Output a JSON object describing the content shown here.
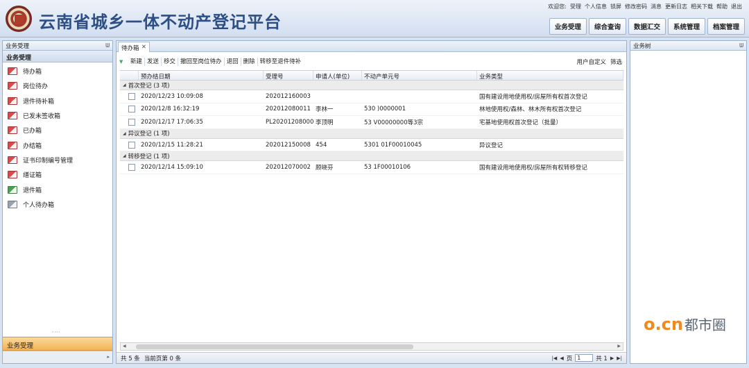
{
  "header": {
    "app_title": "云南省城乡一体不动产登记平台",
    "welcome": "欢迎您:",
    "user": "受理",
    "links": [
      "个人信息",
      "锁屏",
      "修改密码",
      "消息",
      "更新日志",
      "相关下载",
      "帮助",
      "退出"
    ],
    "nav": [
      "业务受理",
      "综合查询",
      "数据汇交",
      "系统管理",
      "档案管理"
    ]
  },
  "left_panel": {
    "title": "业务受理",
    "group": "业务受理",
    "items": [
      {
        "label": "待办箱",
        "icon": "book-red-icon"
      },
      {
        "label": "岗位待办",
        "icon": "book-red-icon"
      },
      {
        "label": "退件待补箱",
        "icon": "book-red-icon"
      },
      {
        "label": "已发未签收箱",
        "icon": "book-red-icon"
      },
      {
        "label": "已办箱",
        "icon": "book-red-icon"
      },
      {
        "label": "办结箱",
        "icon": "book-red-icon"
      },
      {
        "label": "证书印制编号管理",
        "icon": "book-red-icon"
      },
      {
        "label": "缮证箱",
        "icon": "book-red-icon"
      },
      {
        "label": "退件箱",
        "icon": "book-green-icon"
      },
      {
        "label": "个人待办箱",
        "icon": "book-gray-icon"
      }
    ],
    "bottom_tab": "业务受理"
  },
  "center": {
    "tab_label": "待办箱",
    "toolbar": [
      "新建",
      "发送",
      "移交",
      "撤回至岗位待办",
      "退回",
      "删除",
      "转移至退件待补"
    ],
    "toolbar_right": [
      "用户自定义",
      "筛选"
    ],
    "columns": [
      "预办结日期",
      "受理号",
      "申请人(单位)",
      "不动产单元号",
      "业务类型"
    ],
    "groups": [
      {
        "label": "首次登记 (3 项)",
        "rows": [
          [
            "2020/12/23 10:09:08",
            "202012160003",
            "",
            "",
            "国有建设用地使用权/房屋所有权首次登记"
          ],
          [
            "2020/12/8 16:32:19",
            "202012080011",
            "李林一",
            "530                              )0000001",
            "林地使用权/森林、林木所有权首次登记"
          ],
          [
            "2020/12/17 17:06:35",
            "PL20201208000",
            "李顶明",
            "53                              V00000000等3宗",
            "宅基地使用权首次登记（批量）"
          ]
        ]
      },
      {
        "label": "异议登记 (1 项)",
        "rows": [
          [
            "2020/12/15 11:28:21",
            "202012150008",
            "454",
            "5301                        01F00010045",
            "异议登记"
          ]
        ]
      },
      {
        "label": "转移登记 (1 项)",
        "rows": [
          [
            "2020/12/14 15:09:10",
            "202012070002",
            "顾晓芬",
            "53                            1F00010106",
            "国有建设用地使用权/房屋所有权转移登记"
          ]
        ]
      }
    ],
    "status": {
      "total": "共 5 条",
      "selected": "当前页第 0 条",
      "page_prefix": "页",
      "page_value": "1",
      "page_suffix": "共 1"
    }
  },
  "right_panel": {
    "title": "业务树"
  },
  "watermark": {
    "brand_oc": "o.cn",
    "brand_cn": "都市圈"
  }
}
